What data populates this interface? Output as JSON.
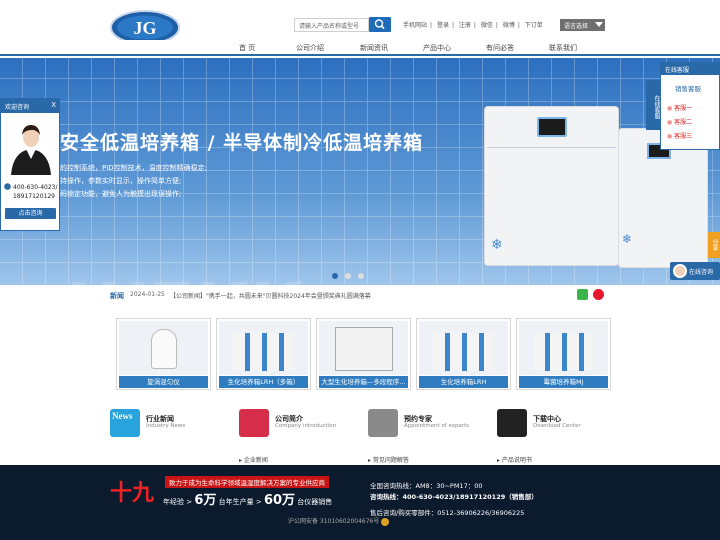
{
  "header": {
    "logo_text": "JG",
    "search_placeholder": "请输入产品名称或型号",
    "links": [
      "手机网站",
      "登录",
      "注册",
      "微信",
      "微博",
      "下订单"
    ],
    "language_label": "语言选择"
  },
  "nav": {
    "items": [
      "首 页",
      "公司介绍",
      "新闻资讯",
      "产品中心",
      "有问必答",
      "联系我们"
    ]
  },
  "banner": {
    "title": "安全低温培养箱 / 半导体制冷低温培养箱",
    "desc": [
      "的控制系统，PID控制技术，温度控制精确稳定;",
      "持操作，参数实时显示，操作简单方便;",
      "码锁定功能，避免人为触摸出现误操作;"
    ],
    "watermark": "WEKK",
    "slides": 3,
    "active_slide": 1
  },
  "side_left": {
    "title": "欢迎咨询",
    "close": "X",
    "phone": "400-630-4023/18917120129",
    "button": "点击咨询"
  },
  "side_right": {
    "title": "在线客服",
    "vertical_label": "在线客服",
    "section": "销售客服",
    "agents": [
      "客服一",
      "客服二",
      "客服三"
    ],
    "share_tab": "分享",
    "chat_label": "在线咨询"
  },
  "ticker": {
    "label": "新闻",
    "date": "2024-01-25",
    "text": "【公司新闻】\"携手一起，共圆未来\"贝圆科技2024年会暨颁奖典礼圆满落幕"
  },
  "products": [
    {
      "caption": "旋涡混匀仪"
    },
    {
      "caption": "生化培养箱LRH（多箱）"
    },
    {
      "caption": "大型生化培养箱—多段程序..."
    },
    {
      "caption": "生化培养箱LRH"
    },
    {
      "caption": "霉菌培养箱MJ"
    }
  ],
  "sections": [
    {
      "icon_badge": "News",
      "title": "行业新闻",
      "subtitle": "Industry News",
      "link": ""
    },
    {
      "title": "公司简介",
      "subtitle": "Company introduction",
      "link": "企业新闻"
    },
    {
      "title": "预约专家",
      "subtitle": "Appointment of experts",
      "link": "常见问题解答"
    },
    {
      "title": "下载中心",
      "subtitle": "Download Center",
      "link": "产品说明书"
    }
  ],
  "footer": {
    "slogan_red": "致力于成为生命科学领域温湿度解决方案的专业供应商",
    "num_big": "十九",
    "years_label": "年经验 >",
    "wan6": "6万",
    "annual_label": "台年生产量 >",
    "wan60": "60万",
    "sales_label": "台仪器销售",
    "hotline_label": "全国咨询热线：AM8：30~PM17：00",
    "hotline": "咨询热线：400-630-4023/18917120129（销售部）",
    "aftersale": "售后咨询/购买零部件：0512-36906226/36906225",
    "icp": "沪公网安备 31010602004676号"
  },
  "colors": {
    "brand_blue": "#2a69a8",
    "footer_bg": "#0b1a2d",
    "accent_red": "#c81414"
  }
}
